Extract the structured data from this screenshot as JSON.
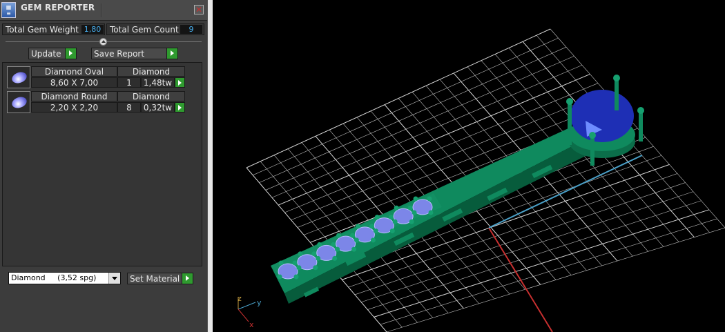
{
  "window": {
    "title": "GEM REPORTER",
    "close_symbol": "✕"
  },
  "stats": {
    "total_weight_label": "Total Gem Weight",
    "total_weight_value": "1,80",
    "total_count_label": "Total Gem Count",
    "total_count_value": "9"
  },
  "toolbar": {
    "update_label": "Update",
    "save_report_label": "Save Report"
  },
  "gems": [
    {
      "name": "Diamond Oval",
      "material": "Diamond",
      "size": "8,60 X 7,00",
      "count": "1",
      "weight": "1,48tw"
    },
    {
      "name": "Diamond Round",
      "material": "Diamond",
      "size": "2,20 X 2,20",
      "count": "8",
      "weight": "0,32tw"
    }
  ],
  "material": {
    "selected": "Diamond     (3,52 spg)",
    "set_label": "Set Material"
  },
  "viewport": {
    "axis_labels": {
      "x": "x",
      "y": "y",
      "z": "z"
    },
    "colors": {
      "grid": "#bfbfbf",
      "metal": "#0f8a5e",
      "gem": "#1e2fb5",
      "axis_x": "#c83030",
      "axis_y": "#4aa0c8"
    }
  },
  "icons": {
    "app": "app-logo-icon",
    "close": "close-icon",
    "collapse": "collapse-arrow-icon",
    "play": "play-arrow-icon",
    "dropdown": "chevron-down-icon"
  }
}
